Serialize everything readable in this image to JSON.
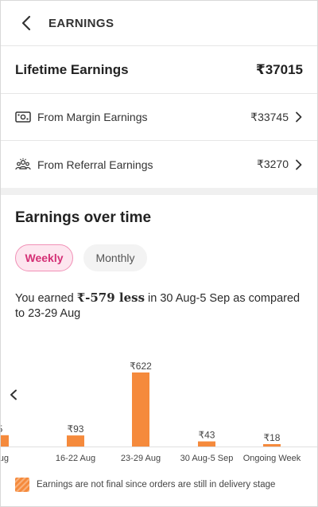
{
  "header": {
    "title": "EARNINGS",
    "back_icon": "chevron-left-icon"
  },
  "lifetime": {
    "label": "Lifetime Earnings",
    "value": "₹37015"
  },
  "margin": {
    "label": "From Margin Earnings",
    "value": "₹33745",
    "icon": "cash-icon"
  },
  "referral": {
    "label": "From Referral Earnings",
    "value": "₹3270",
    "icon": "people-icon"
  },
  "section": {
    "title": "Earnings over time"
  },
  "toggle": {
    "weekly": "Weekly",
    "monthly": "Monthly",
    "selected": "Weekly"
  },
  "summary": {
    "prefix": "You earned ",
    "amount": "₹-579 less",
    "suffix": " in 30 Aug-5 Sep as compared to 23-29 Aug"
  },
  "colors": {
    "bar": "#f58a3c",
    "accent_pink": "#d42f75"
  },
  "chart_data": {
    "type": "bar",
    "categories": [
      "Aug",
      "16-22 Aug",
      "23-29 Aug",
      "30 Aug-5 Sep",
      "Ongoing Week"
    ],
    "value_labels": [
      "5",
      "₹93",
      "₹622",
      "₹43",
      "₹18"
    ],
    "values": [
      95,
      93,
      622,
      43,
      18
    ],
    "title": "",
    "xlabel": "",
    "ylabel": "",
    "ylim": [
      0,
      622
    ],
    "grid": false,
    "legend": "none"
  },
  "footer": {
    "note": "Earnings are not final since orders are still in delivery stage"
  }
}
